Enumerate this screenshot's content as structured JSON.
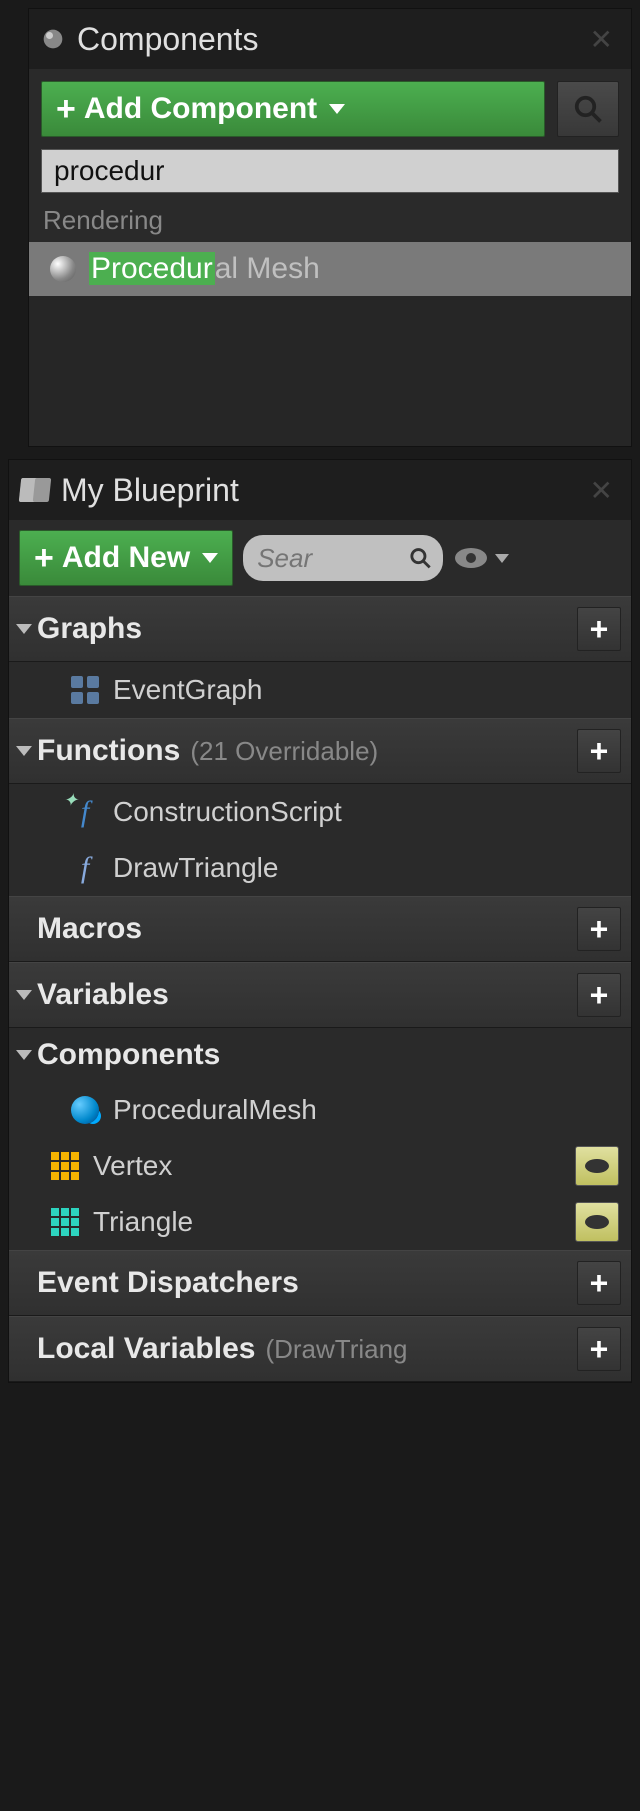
{
  "components_panel": {
    "title": "Components",
    "add_button": "Add Component",
    "search_value": "procedur",
    "category": "Rendering",
    "result_highlight": "Procedur",
    "result_rest": "al Mesh"
  },
  "blueprint_panel": {
    "title": "My Blueprint",
    "add_button": "Add New",
    "search_placeholder": "Sear",
    "sections": {
      "graphs": {
        "title": "Graphs",
        "items": [
          {
            "label": "EventGraph"
          }
        ]
      },
      "functions": {
        "title": "Functions",
        "subtitle": "(21 Overridable)",
        "items": [
          {
            "label": "ConstructionScript"
          },
          {
            "label": "DrawTriangle"
          }
        ]
      },
      "macros": {
        "title": "Macros"
      },
      "variables": {
        "title": "Variables"
      },
      "components": {
        "title": "Components",
        "items": [
          {
            "label": "ProceduralMesh"
          },
          {
            "label": "Vertex"
          },
          {
            "label": "Triangle"
          }
        ]
      },
      "event_dispatchers": {
        "title": "Event Dispatchers"
      },
      "local_variables": {
        "title": "Local Variables",
        "subtitle": "(DrawTriang"
      }
    }
  }
}
